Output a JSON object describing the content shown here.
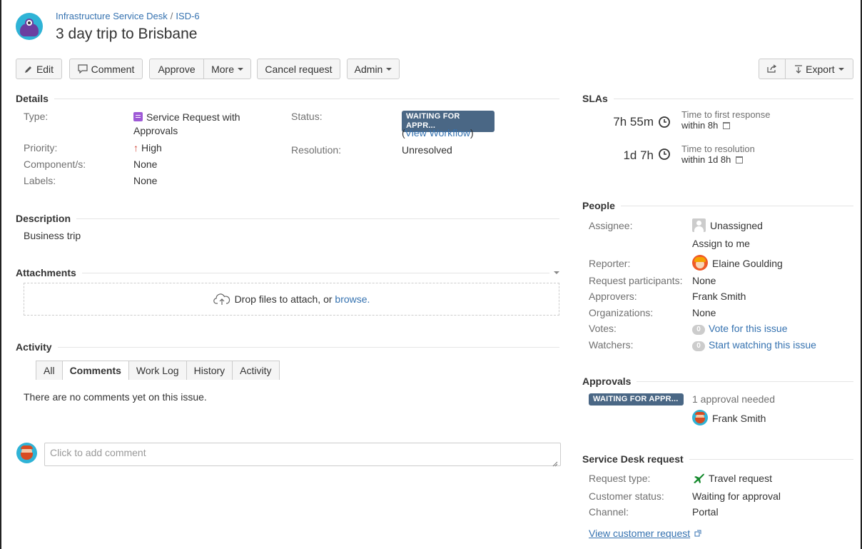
{
  "header": {
    "project": "Infrastructure Service Desk",
    "separator": "/",
    "issue_key": "ISD-6",
    "title": "3 day trip to Brisbane"
  },
  "toolbar": {
    "edit": "Edit",
    "comment": "Comment",
    "approve": "Approve",
    "more": "More",
    "cancel_request": "Cancel request",
    "admin": "Admin",
    "export": "Export"
  },
  "details": {
    "heading": "Details",
    "type_label": "Type:",
    "type_value_line1": "Service Request with",
    "type_value_line2": "Approvals",
    "priority_label": "Priority:",
    "priority_value": "High",
    "components_label": "Component/s:",
    "components_value": "None",
    "labels_label": "Labels:",
    "labels_value": "None",
    "status_label": "Status:",
    "status_value": "WAITING FOR APPR...",
    "view_workflow_open": "(",
    "view_workflow": "View Workflow",
    "view_workflow_close": ")",
    "resolution_label": "Resolution:",
    "resolution_value": "Unresolved"
  },
  "description": {
    "heading": "Description",
    "text": "Business trip"
  },
  "attachments": {
    "heading": "Attachments",
    "drop_text": "Drop files to attach, or",
    "browse": "browse."
  },
  "activity": {
    "heading": "Activity",
    "tabs": [
      "All",
      "Comments",
      "Work Log",
      "History",
      "Activity"
    ],
    "active_tab": "Comments",
    "empty_text": "There are no comments yet on this issue.",
    "comment_placeholder": "Click to add comment"
  },
  "slas": {
    "heading": "SLAs",
    "items": [
      {
        "time": "7h 55m",
        "name": "Time to first response",
        "within": "within 8h"
      },
      {
        "time": "1d 7h",
        "name": "Time to resolution",
        "within": "within 1d 8h"
      }
    ]
  },
  "people": {
    "heading": "People",
    "assignee_label": "Assignee:",
    "assignee_value": "Unassigned",
    "assign_to_me": "Assign to me",
    "reporter_label": "Reporter:",
    "reporter_value": "Elaine Goulding",
    "participants_label": "Request participants:",
    "participants_value": "None",
    "approvers_label": "Approvers:",
    "approvers_value": "Frank Smith",
    "organizations_label": "Organizations:",
    "organizations_value": "None",
    "votes_label": "Votes:",
    "votes_count": "0",
    "votes_link": "Vote for this issue",
    "watchers_label": "Watchers:",
    "watchers_count": "0",
    "watchers_link": "Start watching this issue"
  },
  "approvals": {
    "heading": "Approvals",
    "status": "WAITING FOR APPR...",
    "needed": "1 approval needed",
    "approver": "Frank Smith"
  },
  "service_desk": {
    "heading": "Service Desk request",
    "request_type_label": "Request type:",
    "request_type_value": "Travel request",
    "customer_status_label": "Customer status:",
    "customer_status_value": "Waiting for approval",
    "channel_label": "Channel:",
    "channel_value": "Portal",
    "view_customer_request": "View customer request"
  },
  "colors": {
    "link": "#3572b0",
    "lozenge": "#4a6785",
    "priority_high": "#d04437",
    "type_icon": "#9e59d6",
    "travel_icon": "#14892c"
  }
}
